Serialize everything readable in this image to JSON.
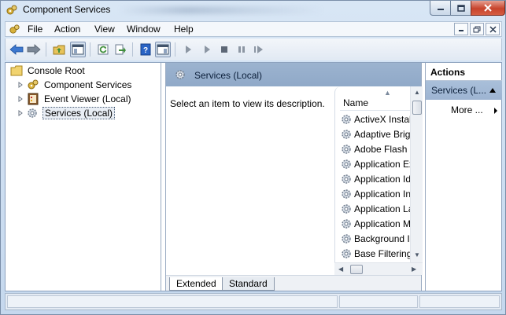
{
  "window": {
    "title": "Component Services"
  },
  "menu": {
    "items": [
      "File",
      "Action",
      "View",
      "Window",
      "Help"
    ]
  },
  "tree": {
    "root": "Console Root",
    "children": [
      "Component Services",
      "Event Viewer (Local)",
      "Services (Local)"
    ],
    "selected_index": 2
  },
  "center": {
    "header": "Services (Local)",
    "description": "Select an item to view its description.",
    "list_header": "Name",
    "rows": [
      "ActiveX Installer",
      "Adaptive Brightness",
      "Adobe Flash Player",
      "Application Experience",
      "Application Identity",
      "Application Information",
      "Application Layer",
      "Application Management",
      "Background Intelligent",
      "Base Filtering Engine"
    ],
    "tabs": [
      "Extended",
      "Standard"
    ]
  },
  "actions": {
    "title": "Actions",
    "selected": "Services (L...",
    "more": "More ..."
  },
  "colors": {
    "header_bg": "#9cb3cf",
    "accent_blue": "#2a64c5",
    "play_green": "#3f8f3b"
  },
  "icons": {
    "toolbar": [
      "back-arrow-icon",
      "forward-arrow-icon",
      "up-folder-icon",
      "show-hide-tree-icon",
      "refresh-icon",
      "export-list-icon",
      "help-icon",
      "show-hide-action-pane-icon",
      "start-service-icon",
      "start-service-alt-icon",
      "stop-service-icon",
      "pause-service-icon",
      "restart-service-icon"
    ]
  }
}
